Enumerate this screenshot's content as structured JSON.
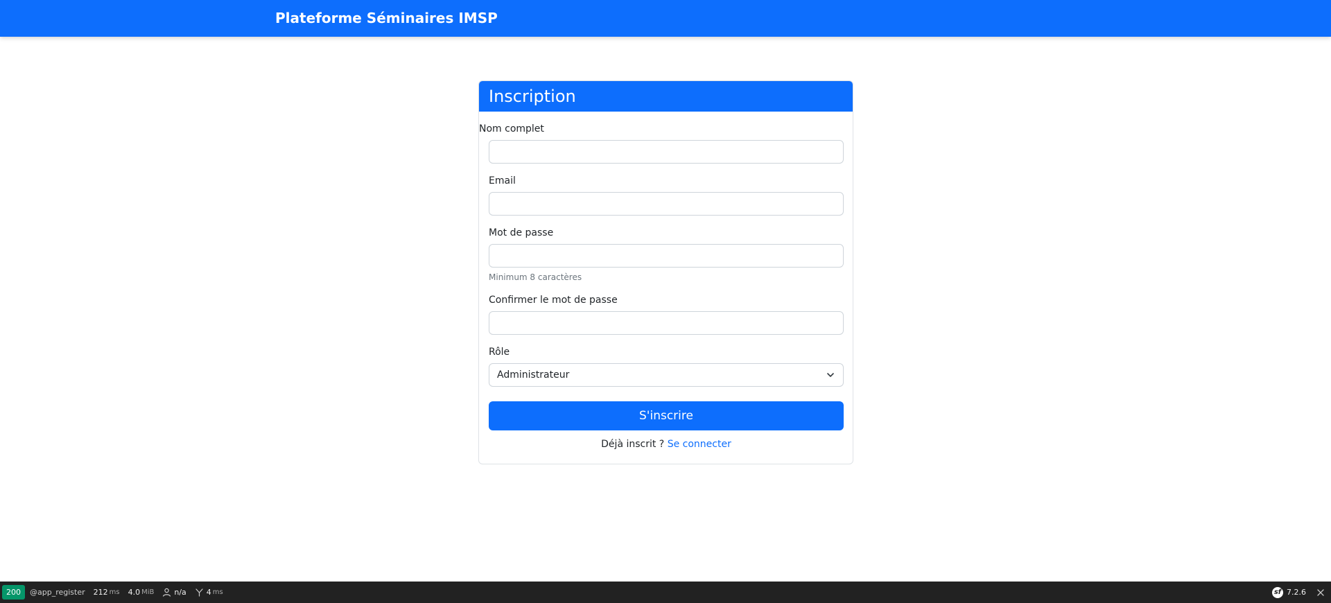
{
  "navbar": {
    "brand": "Plateforme Séminaires IMSP"
  },
  "form": {
    "title": "Inscription",
    "full_name": {
      "label": "Nom complet",
      "value": "",
      "placeholder": ""
    },
    "email": {
      "label": "Email",
      "value": "",
      "placeholder": ""
    },
    "password": {
      "label": "Mot de passe",
      "value": "",
      "placeholder": "",
      "help": "Minimum 8 caractères"
    },
    "confirm_password": {
      "label": "Confirmer le mot de passe",
      "value": "",
      "placeholder": ""
    },
    "role": {
      "label": "Rôle",
      "selected": "Administrateur"
    },
    "submit_label": "S'inscrire",
    "login_prompt": "Déjà inscrit ?",
    "login_link": "Se connecter"
  },
  "toolbar": {
    "status_code": "200",
    "route": "@app_register",
    "time_value": "212",
    "time_unit": "ms",
    "memory_value": "4.0",
    "memory_unit": "MiB",
    "user": "n/a",
    "db_value": "4",
    "db_unit": "ms",
    "version": "7.2.6",
    "icons": {
      "user": "user-icon",
      "db": "database-icon",
      "logo": "symfony-logo-icon",
      "close": "close-icon"
    }
  },
  "colors": {
    "primary": "#0d6efd",
    "toolbar_bg": "#222222",
    "status_ok": "#059669"
  }
}
